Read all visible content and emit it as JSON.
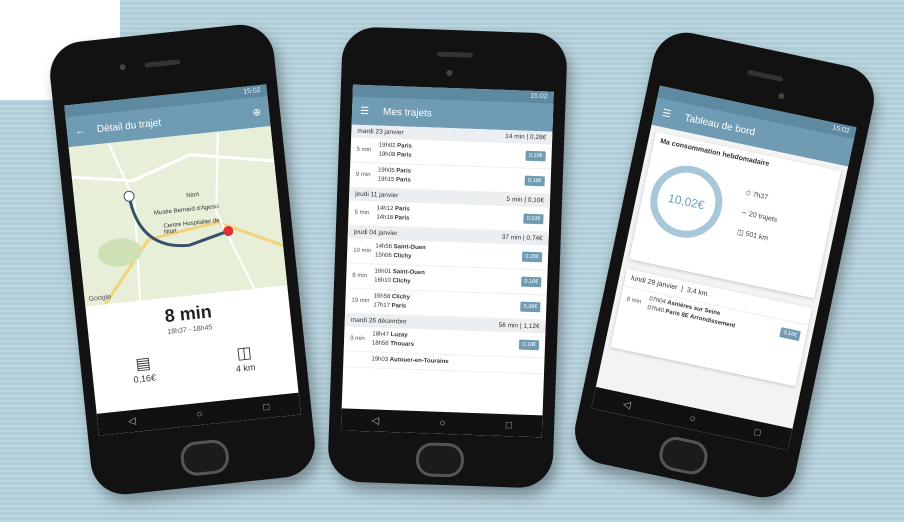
{
  "phone1": {
    "status_time": "15:02",
    "title": "Détail du trajet",
    "map_places": [
      "Niort",
      "Musée Bernard d'Agesci",
      "Centre Hospitalier de Niort"
    ],
    "map_brand": "Google",
    "duration": "8 min",
    "time_range": "18h37 - 18h45",
    "price": "0,16€",
    "distance": "4 km"
  },
  "phone2": {
    "status_time": "15:02",
    "title": "Mes trajets",
    "days": [
      {
        "date": "mardi 23 janvier",
        "summary": "14 min | 0,28€",
        "trips": [
          {
            "dur": "5 min",
            "t1": "19h02",
            "p1": "Paris",
            "t2": "19h08",
            "p2": "Paris",
            "price": "0,10€"
          },
          {
            "dur": "9 min",
            "t1": "19h05",
            "p1": "Paris",
            "t2": "19h15",
            "p2": "Paris",
            "price": "0,18€"
          }
        ]
      },
      {
        "date": "jeudi 11 janvier",
        "summary": "5 min | 0,10€",
        "trips": [
          {
            "dur": "5 min",
            "t1": "14h12",
            "p1": "Paris",
            "t2": "14h18",
            "p2": "Paris",
            "price": "0,10€"
          }
        ]
      },
      {
        "date": "jeudi 04 janvier",
        "summary": "37 min | 0,74€",
        "trips": [
          {
            "dur": "10 min",
            "t1": "14h56",
            "p1": "Saint-Ouen",
            "t2": "15h06",
            "p2": "Clichy",
            "price": "0,20€"
          },
          {
            "dur": "8 min",
            "t1": "16h01",
            "p1": "Saint-Ouen",
            "t2": "16h10",
            "p2": "Clichy",
            "price": "0,16€"
          },
          {
            "dur": "19 min",
            "t1": "16h58",
            "p1": "Clichy",
            "t2": "17h17",
            "p2": "Paris",
            "price": "0,38€"
          }
        ]
      },
      {
        "date": "mardi 26 décembre",
        "summary": "56 min | 1,12€",
        "trips": [
          {
            "dur": "9 min",
            "t1": "18h47",
            "p1": "Luzay",
            "t2": "18h56",
            "p2": "Thouars",
            "price": "0,18€"
          },
          {
            "dur": "",
            "t1": "19h03",
            "p1": "Autouer-en-Touraine",
            "t2": "",
            "p2": "",
            "price": ""
          }
        ]
      }
    ]
  },
  "phone3": {
    "status_time": "15:02",
    "title": "Tableau de bord",
    "card_title": "Ma consommation hebdomadaire",
    "amount": "10,02€",
    "time_stat": "7h37",
    "trips_stat": "20 trajets",
    "km_stat": "501 km",
    "day_date": "lundi 29 janvier",
    "day_dist": "3,4 km",
    "trip_dur": "8 min",
    "from_time": "07h04",
    "from_place": "Asnières sur Seine",
    "to_time": "07h40",
    "to_place": "Paris 8E Arrondissement",
    "trip_price": "0,16€"
  }
}
